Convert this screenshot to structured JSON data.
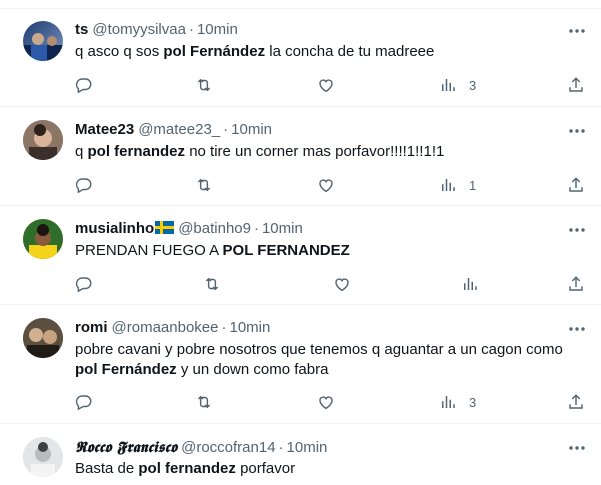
{
  "tweets": [
    {
      "name": "ts",
      "handle": "@tomyysilvaa",
      "time": "10min",
      "text": [
        {
          "t": "q asco q sos ",
          "b": false
        },
        {
          "t": "pol Fernández",
          "b": true
        },
        {
          "t": " la concha de tu madreee",
          "b": false
        }
      ],
      "views": "3",
      "avatar_colors": [
        "#1d3b6e",
        "#7d96c4"
      ]
    },
    {
      "name": "Matee23",
      "handle": "@matee23_",
      "time": "10min",
      "text": [
        {
          "t": "q ",
          "b": false
        },
        {
          "t": "pol fernandez",
          "b": true
        },
        {
          "t": " no tire un corner mas porfavor!!!!1!!1!1",
          "b": false
        }
      ],
      "views": "1",
      "avatar_colors": [
        "#b98e73",
        "#4a3a30"
      ]
    },
    {
      "name": "musialinho",
      "handle": "@batinho9",
      "time": "10min",
      "text": [
        {
          "t": "PRENDAN FUEGO A ",
          "b": false
        },
        {
          "t": "POL FERNANDEZ",
          "b": true
        }
      ],
      "views": "",
      "avatar_colors": [
        "#f5d21a",
        "#2f6e2a"
      ]
    },
    {
      "name": "romi",
      "handle": "@romaanbokee",
      "time": "10min",
      "text": [
        {
          "t": "pobre cavani y pobre nosotros que tenemos q aguantar a un cagon como ",
          "b": false
        },
        {
          "t": "pol Fernández",
          "b": true
        },
        {
          "t": " y un down como fabra",
          "b": false
        }
      ],
      "views": "3",
      "avatar_colors": [
        "#8a7a62",
        "#2b2620"
      ]
    },
    {
      "name": "𝕽𝖔𝖈𝖈𝖔 𝕱𝖗𝖆𝖓𝖈𝖎𝖘𝖈𝖔",
      "handle": "@roccofran14",
      "time": "10min",
      "text": [
        {
          "t": "Basta de ",
          "b": false
        },
        {
          "t": "pol fernandez",
          "b": true
        },
        {
          "t": " porfavor",
          "b": false
        }
      ],
      "views": "",
      "avatar_colors": [
        "#d9dcdf",
        "#6c7075"
      ]
    }
  ]
}
